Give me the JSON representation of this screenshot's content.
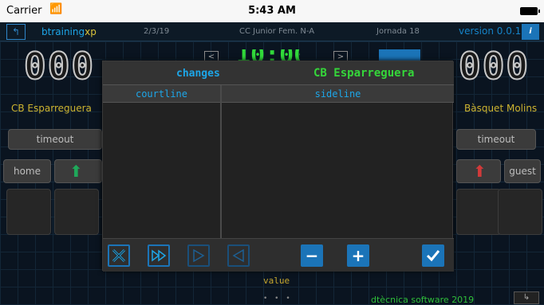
{
  "status_bar": {
    "carrier": "Carrier",
    "time": "5:43 AM"
  },
  "app_bar": {
    "brand": "btraining",
    "brand_suffix": "xp",
    "date": "2/3/19",
    "competition": "CC Junior Fem. N-A",
    "jornada": "Jornada 18",
    "version": "version 0.0.1",
    "info_label": "i"
  },
  "scoreboard": {
    "home_score": "000",
    "guest_score": "000",
    "home_team": "CB Esparreguera",
    "guest_team": "Bàsquet Molins",
    "timeout_left": "timeout",
    "timeout_right": "timeout",
    "home_label": "home",
    "guest_label": "guest",
    "value_label": "value",
    "footer_text": "dtècnica software 2019",
    "page_dots": "• • •"
  },
  "changes_panel": {
    "title": "changes",
    "team": "CB Esparreguera",
    "courtline_header": "courtline",
    "sideline_header": "sideline",
    "courtline_players": [],
    "sideline_players": []
  },
  "colors": {
    "accent_blue": "#1da6e8",
    "accent_green": "#35d63a",
    "team_gold": "#cdb430",
    "up_green": "#1fa85a",
    "up_red": "#d23a3a"
  }
}
